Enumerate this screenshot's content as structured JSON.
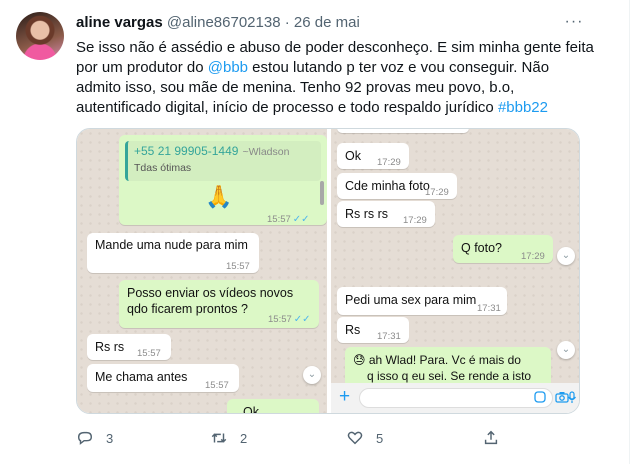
{
  "tweet": {
    "author_name": "aline vargas",
    "handle": "@aline86702138",
    "separator": "·",
    "date": "26 de mai",
    "more": "···",
    "lines": [
      [
        {
          "t": "Se isso não é assédio e abuso de poder desconheço. E sim minha gente feita"
        }
      ],
      [
        {
          "t": "por um produtor do "
        },
        {
          "t": "@bbb",
          "link": true
        },
        {
          "t": " estou lutando p ter voz e vou conseguir. Não"
        }
      ],
      [
        {
          "t": "admito isso, sou mãe de menina. Tenho 92 provas meu povo, b.o,"
        }
      ],
      [
        {
          "t": "autentificado digital, início de processo e todo respaldo jurídico "
        },
        {
          "t": "#bbb22",
          "link": true
        }
      ]
    ],
    "actions": {
      "reply_count": "3",
      "retweet_count": "2",
      "like_count": "5"
    }
  },
  "chat_left": {
    "quote_phone": "+55 21 99905-1449",
    "quote_sender": "~Wladson",
    "quote_text": "Tdas ótimas",
    "emoji": "🙏",
    "emoji_time": "15:57",
    "msg1": "Mande uma nude para mim",
    "msg1_time": "15:57",
    "msg2_line1": "Posso enviar os vídeos novos",
    "msg2_line2": "qdo ficarem prontos ?",
    "msg2_time": "15:57",
    "msg3": "Rs rs",
    "msg3_time": "15:57",
    "msg4": "Me chama antes",
    "msg4_time": "15:57",
    "msg5_partial": "Ok"
  },
  "chat_right": {
    "msg1": "Ok",
    "msg1_time": "17:29",
    "msg2": "Cde minha foto",
    "msg2_time": "17:29",
    "msg3": "Rs rs rs",
    "msg3_time": "17:29",
    "msg4": "Q foto?",
    "msg4_time": "17:29",
    "msg5": "Pedi uma sex para mim",
    "msg5_time": "17:31",
    "msg6": "Rs",
    "msg6_time": "17:31",
    "msg7_line1": "ah Wlad! Para. Vc é mais do",
    "msg7_line2": "q isso q eu sei. Se rende a isto",
    "msg7_emoji": "😓"
  },
  "icon_names": [
    "more-icon",
    "reply-icon",
    "retweet-icon",
    "like-icon",
    "share-icon",
    "plus-icon",
    "sticker-icon",
    "camera-icon",
    "mic-icon",
    "chevron-down-icon"
  ],
  "colors": {
    "link": "#1d9bf0",
    "meta": "#536471",
    "chat_bg": "#e5ddd5",
    "outgoing_bubble": "#dcf8c6"
  }
}
